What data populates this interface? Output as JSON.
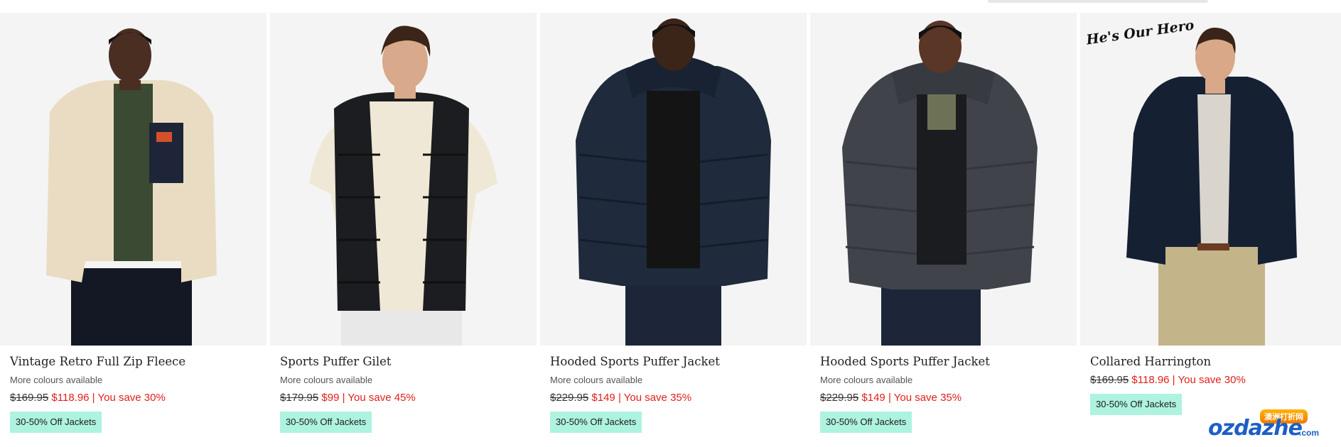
{
  "products": [
    {
      "title": "Vintage Retro Full Zip Fleece",
      "more": "More colours available",
      "was": "$169.95",
      "now": "$118.96 | You save 30%",
      "badge": "30-50% Off Jackets",
      "image": "man-cream-sherpa-fleece"
    },
    {
      "title": "Sports Puffer Gilet",
      "more": "More colours available",
      "was": "$179.95",
      "now": "$99 | You save 45%",
      "badge": "30-50% Off Jackets",
      "image": "man-black-puffer-gilet"
    },
    {
      "title": "Hooded Sports Puffer Jacket",
      "more": "More colours available",
      "was": "$229.95",
      "now": "$149 | You save 35%",
      "badge": "30-50% Off Jackets",
      "image": "man-navy-hooded-puffer"
    },
    {
      "title": "Hooded Sports Puffer Jacket",
      "more": "More colours available",
      "was": "$229.95",
      "now": "$149 | You save 35%",
      "badge": "30-50% Off Jackets",
      "image": "man-grey-hooded-puffer"
    },
    {
      "title": "Collared Harrington",
      "was": "$169.95",
      "now": "$118.96 | You save 30%",
      "badge": "30-50% Off Jackets",
      "image": "man-navy-harrington",
      "tag": "He's Our Hero"
    }
  ],
  "watermark": {
    "top": "澳洲打折网",
    "main": "ozdazhe",
    "suffix": ".com"
  }
}
